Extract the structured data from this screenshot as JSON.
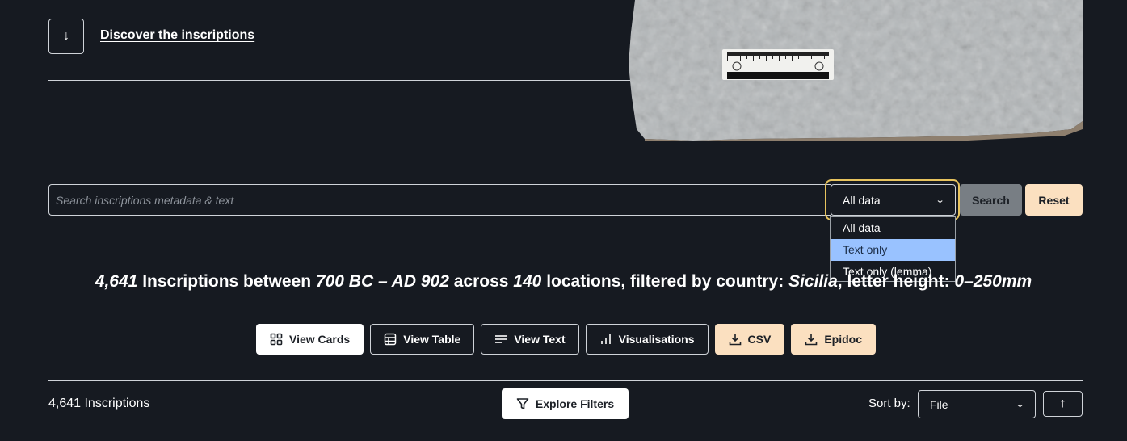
{
  "hero": {
    "down_arrow": "↓",
    "discover_label": "Discover the inscriptions"
  },
  "search": {
    "placeholder": "Search inscriptions metadata & text",
    "scope_selected": "All data",
    "scope_options": [
      "All data",
      "Text only",
      "Text only (lemma)"
    ],
    "highlighted_option": "Text only",
    "search_label": "Search",
    "reset_label": "Reset"
  },
  "summary": {
    "count": "4,641",
    "text_1": "Inscriptions between",
    "date_range": "700 BC – AD 902",
    "text_2": "across",
    "locations": "140",
    "text_3": "locations, filtered by country:",
    "country": "Sicilia",
    "text_4": ", letter height:",
    "letter_height": "0–250mm"
  },
  "views": {
    "cards": "View Cards",
    "table": "View Table",
    "text": "View Text",
    "visualisations": "Visualisations",
    "csv": "CSV",
    "epidoc": "Epidoc"
  },
  "toolbar": {
    "count_label": "4,641 Inscriptions",
    "filters_label": "Explore Filters",
    "sort_label": "Sort by:",
    "sort_value": "File",
    "sort_dir_icon": "↑"
  },
  "colors": {
    "background": "#161a21",
    "accent_peach": "#fbe0c0",
    "focus_ring": "#e7c35e",
    "option_highlight": "#99c2ff"
  }
}
